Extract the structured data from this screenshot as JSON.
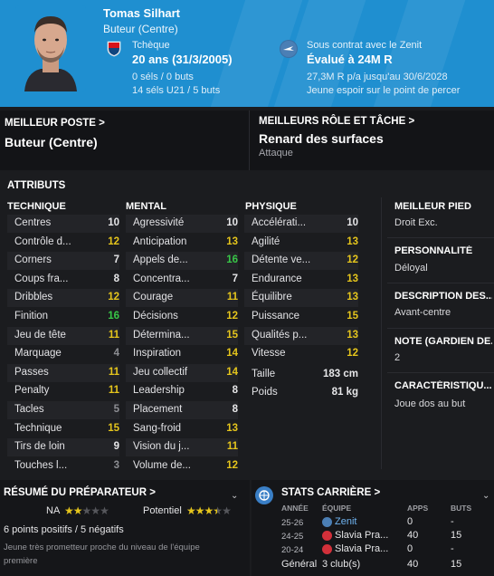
{
  "header": {
    "name": "Tomas Silhart",
    "position": "Buteur (Centre)",
    "nationality": "Tchèque",
    "age": "20 ans (31/3/2005)",
    "caps": "0 séls / 0 buts",
    "u21_caps": "14 séls U21 / 5 buts",
    "contract": "Sous contrat avec le Zenit",
    "value": "Évalué à 24M R",
    "wage": "27,3M R p/a jusqu'au 30/6/2028",
    "status": "Jeune espoir sur le point de percer",
    "colors": {
      "header_bg": "#1f8fd0"
    }
  },
  "best_position": {
    "label": "MEILLEUR POSTE >",
    "value": "Buteur (Centre)"
  },
  "best_role": {
    "label": "MEILLEURS RÔLE ET TÂCHE >",
    "value": "Renard des surfaces",
    "duty": "Attaque"
  },
  "attributes": {
    "title": "ATTRIBUTS",
    "technique_title": "TECHNIQUE",
    "mental_title": "MENTAL",
    "physique_title": "PHYSIQUE",
    "technique": [
      {
        "name": "Centres",
        "value": "10",
        "color": "w"
      },
      {
        "name": "Contrôle d...",
        "value": "12",
        "color": "y"
      },
      {
        "name": "Corners",
        "value": "7",
        "color": "w"
      },
      {
        "name": "Coups fra...",
        "value": "8",
        "color": "w"
      },
      {
        "name": "Dribbles",
        "value": "12",
        "color": "y"
      },
      {
        "name": "Finition",
        "value": "16",
        "color": "g"
      },
      {
        "name": "Jeu de tête",
        "value": "11",
        "color": "y"
      },
      {
        "name": "Marquage",
        "value": "4",
        "color": "gray"
      },
      {
        "name": "Passes",
        "value": "11",
        "color": "y"
      },
      {
        "name": "Penalty",
        "value": "11",
        "color": "y"
      },
      {
        "name": "Tacles",
        "value": "5",
        "color": "gray"
      },
      {
        "name": "Technique",
        "value": "15",
        "color": "y"
      },
      {
        "name": "Tirs de loin",
        "value": "9",
        "color": "w"
      },
      {
        "name": "Touches l...",
        "value": "3",
        "color": "gray"
      }
    ],
    "mental": [
      {
        "name": "Agressivité",
        "value": "10",
        "color": "w"
      },
      {
        "name": "Anticipation",
        "value": "13",
        "color": "y"
      },
      {
        "name": "Appels de...",
        "value": "16",
        "color": "g"
      },
      {
        "name": "Concentra...",
        "value": "7",
        "color": "w"
      },
      {
        "name": "Courage",
        "value": "11",
        "color": "y"
      },
      {
        "name": "Décisions",
        "value": "12",
        "color": "y"
      },
      {
        "name": "Détermina...",
        "value": "15",
        "color": "y"
      },
      {
        "name": "Inspiration",
        "value": "14",
        "color": "y"
      },
      {
        "name": "Jeu collectif",
        "value": "14",
        "color": "y"
      },
      {
        "name": "Leadership",
        "value": "8",
        "color": "w"
      },
      {
        "name": "Placement",
        "value": "8",
        "color": "w"
      },
      {
        "name": "Sang-froid",
        "value": "13",
        "color": "y"
      },
      {
        "name": "Vision du j...",
        "value": "11",
        "color": "y"
      },
      {
        "name": "Volume de...",
        "value": "12",
        "color": "y"
      }
    ],
    "physique": [
      {
        "name": "Accélérati...",
        "value": "10",
        "color": "w"
      },
      {
        "name": "Agilité",
        "value": "13",
        "color": "y"
      },
      {
        "name": "Détente ve...",
        "value": "12",
        "color": "y"
      },
      {
        "name": "Endurance",
        "value": "13",
        "color": "y"
      },
      {
        "name": "Équilibre",
        "value": "13",
        "color": "y"
      },
      {
        "name": "Puissance",
        "value": "15",
        "color": "y"
      },
      {
        "name": "Qualités p...",
        "value": "13",
        "color": "y"
      },
      {
        "name": "Vitesse",
        "value": "12",
        "color": "y"
      }
    ],
    "height_label": "Taille",
    "height": "183 cm",
    "weight_label": "Poids",
    "weight": "81 kg"
  },
  "side": {
    "best_foot_label": "MEILLEUR PIED",
    "best_foot": "Droit Exc.",
    "personality_label": "PERSONNALITÉ",
    "personality": "Déloyal",
    "description_label": "DESCRIPTION DES...",
    "description": "Avant-centre",
    "note_label": "NOTE (GARDIEN DE...",
    "note": "2",
    "traits_label": "CARACTÉRISTIQU...",
    "traits": "Joue dos au but"
  },
  "coach_report": {
    "title": "RÉSUMÉ DU PRÉPARATEUR >",
    "current_label": "NA",
    "current_stars": 2,
    "potential_label": "Potentiel",
    "potential_stars": 3.5,
    "summary": "6 points positifs / 5 négatifs",
    "comment": "Jeune très prometteur proche du niveau de l'équipe première"
  },
  "career": {
    "title": "STATS CARRIÈRE >",
    "headers": {
      "year": "ANNÉE",
      "team": "ÉQUIPE",
      "apps": "APPS",
      "goals": "BUTS"
    },
    "rows": [
      {
        "year": "25-26",
        "team": "Zenit",
        "apps": "0",
        "goals": "-"
      },
      {
        "year": "24-25",
        "team": "Slavia Pra...",
        "apps": "40",
        "goals": "15"
      },
      {
        "year": "20-24",
        "team": "Slavia Pra...",
        "apps": "0",
        "goals": "-"
      }
    ],
    "total_label": "Général",
    "total_team": "3 club(s)",
    "total_apps": "40",
    "total_goals": "15"
  }
}
